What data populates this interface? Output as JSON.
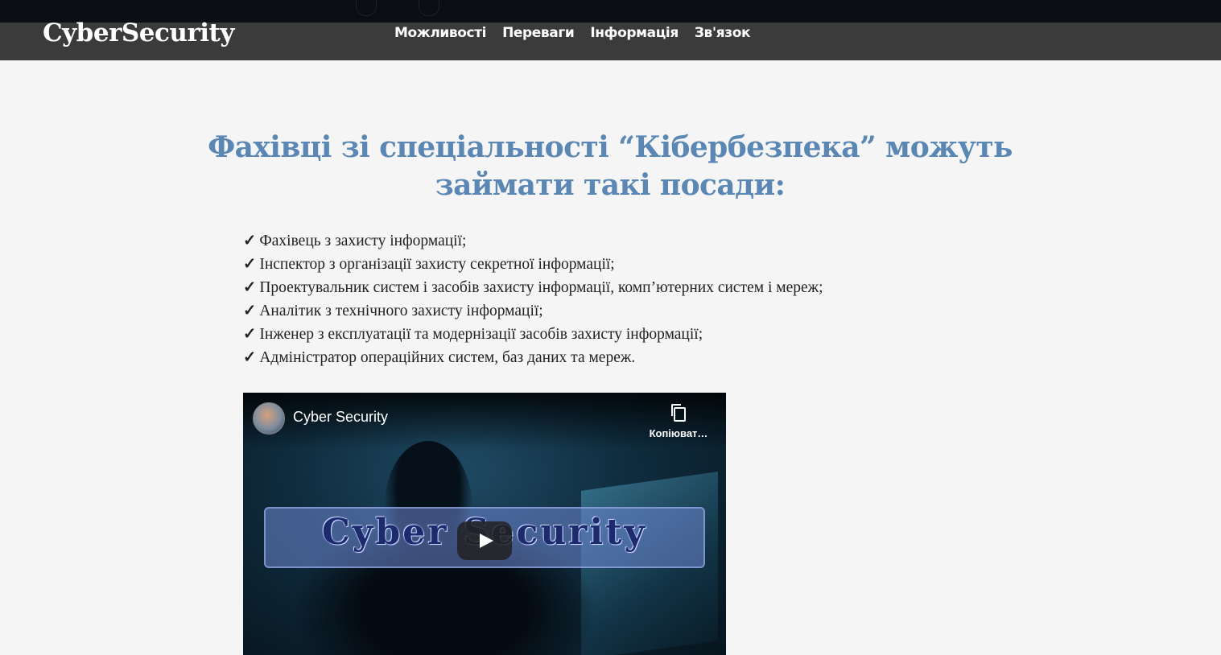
{
  "header": {
    "logo": "CyberSecurity",
    "nav": [
      {
        "label": "Можливості"
      },
      {
        "label": "Переваги"
      },
      {
        "label": "Інформація"
      },
      {
        "label": "Зв'язок"
      }
    ]
  },
  "main": {
    "title": "Фахівці зі спеціальності “Кібербезпека” можуть займати такі посади:",
    "check_symbol": "✓",
    "positions": [
      "Фахівець з захисту інформації;",
      "Інспектор з організації захисту секретної інформації;",
      "Проектувальник систем і засобів захисту інформації, комп’ютерних систем і мереж;",
      "Аналітик з технічного захисту інформації;",
      "Інженер з експлуатації та модернізації засобів захисту інформації;",
      "Адміністратор операційних систем, баз даних та мереж."
    ]
  },
  "video": {
    "title": "Cyber Security",
    "copy_label": "Копіюват…",
    "thumbnail_text": "Cyber Security",
    "icons": [
      "avatar",
      "copy-icon",
      "play-icon"
    ]
  }
}
